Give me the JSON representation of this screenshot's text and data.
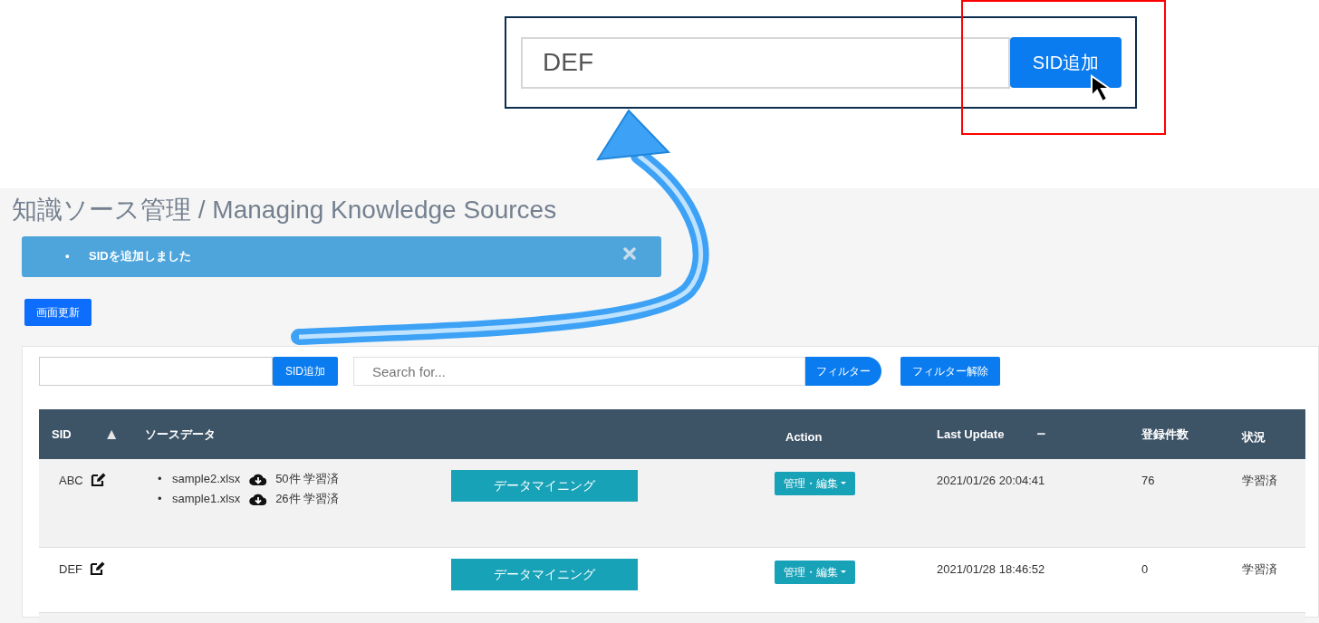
{
  "callout": {
    "sid_field": {
      "value": "DEF"
    },
    "add_button": "SID追加"
  },
  "page_title": "知識ソース管理 / Managing Knowledge Sources",
  "alert": {
    "messages": [
      {
        "bullet": "•",
        "text": "SIDを追加しました"
      }
    ]
  },
  "refresh_button": "画面更新",
  "toolbar": {
    "add_button": "SID追加",
    "search_field": {
      "placeholder": "Search for..."
    },
    "filter_button": "フィルター",
    "clear_filter_button": "フィルター解除"
  },
  "table": {
    "columns": [
      {
        "label": "SID",
        "sort_mark": "▲"
      },
      {
        "label": "ソースデータ"
      },
      {
        "label": "Action"
      },
      {
        "label": "Last Update",
        "sort_mark": "−"
      },
      {
        "label": "登録件数"
      },
      {
        "label": "状況"
      }
    ],
    "rows": [
      {
        "sid": "ABC",
        "files": [
          {
            "bullet": "•",
            "name": "sample2.xlsx",
            "summary": "50件 学習済"
          },
          {
            "bullet": "•",
            "name": "sample1.xlsx",
            "summary": "26件 学習済"
          }
        ],
        "mining_button": "データマイニング",
        "action_button": "管理・編集",
        "last_update": "2021/01/26 20:04:41",
        "count": "76",
        "status": "学習済"
      },
      {
        "sid": "DEF",
        "files": [],
        "mining_button": "データマイニング",
        "action_button": "管理・編集",
        "last_update": "2021/01/28 18:46:52",
        "count": "0",
        "status": "学習済"
      }
    ]
  }
}
